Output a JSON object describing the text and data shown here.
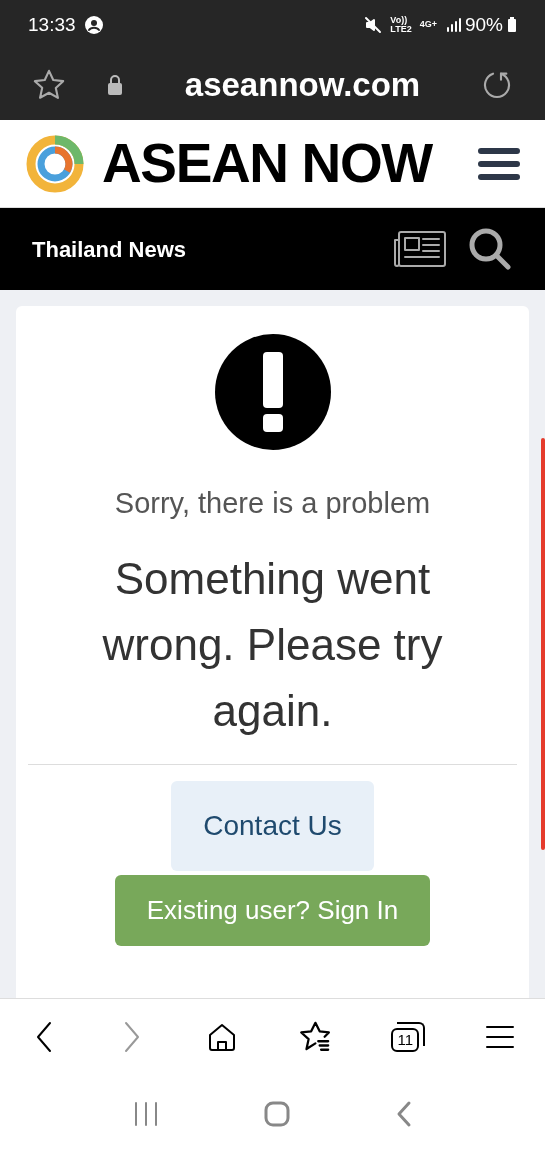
{
  "status_bar": {
    "time": "13:33",
    "volte": "Vo))",
    "lte": "LTE2",
    "network": "4G+",
    "battery": "90%"
  },
  "address_bar": {
    "url": "aseannow.com"
  },
  "site_header": {
    "logo_text": "ASEAN NOW"
  },
  "nav_bar": {
    "title": "Thailand News"
  },
  "error_card": {
    "subtitle": "Sorry, there is a problem",
    "message": "Something went wrong. Please try again.",
    "buttons": [
      {
        "label": "Contact Us",
        "kind": "secondary"
      },
      {
        "label": "Existing user? Sign In",
        "kind": "primary"
      }
    ]
  },
  "browser_toolbar": {
    "tab_count": "11",
    "forward_disabled": true
  }
}
